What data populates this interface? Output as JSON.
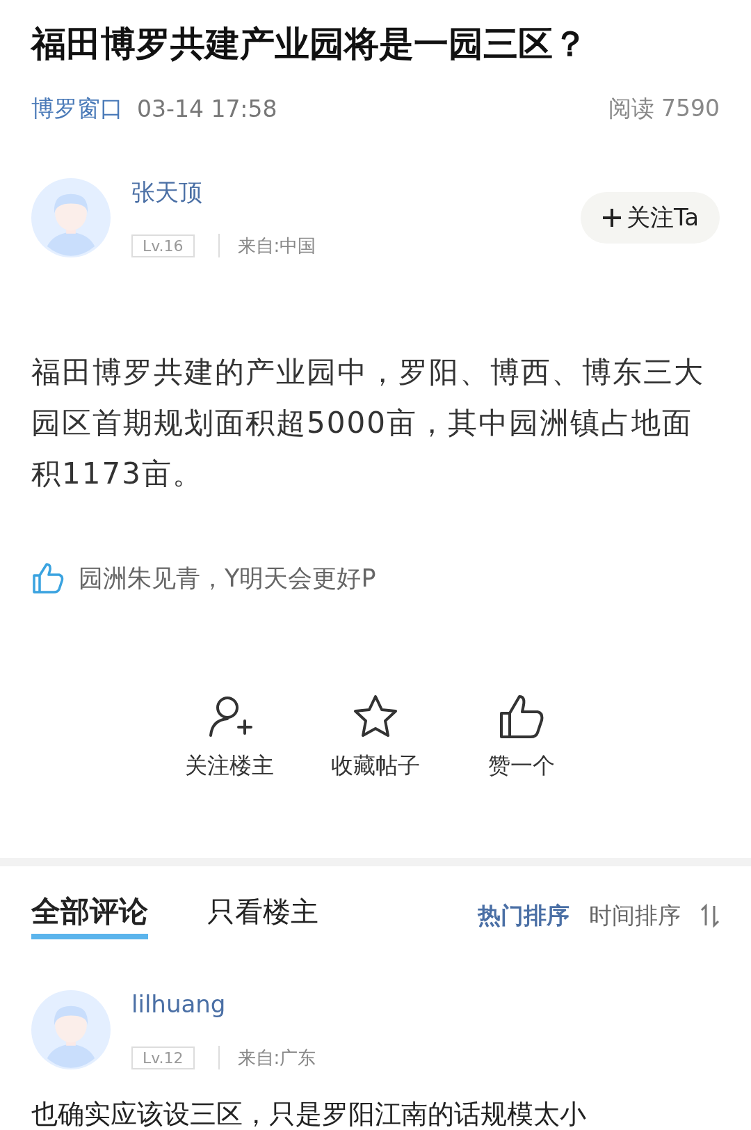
{
  "title": "福田博罗共建产业园将是一园三区？",
  "meta": {
    "source": "博罗窗口",
    "time": "03-14 17:58",
    "reads": "阅读 7590"
  },
  "author": {
    "name": "张天顶",
    "level": "Lv.16",
    "location": "来自:中国",
    "follow_button": "关注Ta"
  },
  "body": "福田博罗共建的产业园中，罗阳、博西、博东三大园区首期规划面积超5000亩，其中园洲镇占地面积1173亩。",
  "likes": {
    "text": "园洲朱见青，Y明天会更好P"
  },
  "actions": [
    {
      "kind": "follow",
      "label": "关注楼主"
    },
    {
      "kind": "favorite",
      "label": "收藏帖子"
    },
    {
      "kind": "like",
      "label": "赞一个"
    }
  ],
  "comment_tabs": [
    {
      "label": "全部评论",
      "selected": true
    },
    {
      "label": "只看楼主",
      "selected": false
    }
  ],
  "sort_options": [
    {
      "label": "热门排序",
      "selected": true
    },
    {
      "label": "时间排序",
      "selected": false
    }
  ],
  "comments": [
    {
      "name": "lilhuang",
      "level": "Lv.12",
      "location": "来自:广东",
      "text": "也确实应该设三区，只是罗阳江南的话规模太小"
    }
  ]
}
